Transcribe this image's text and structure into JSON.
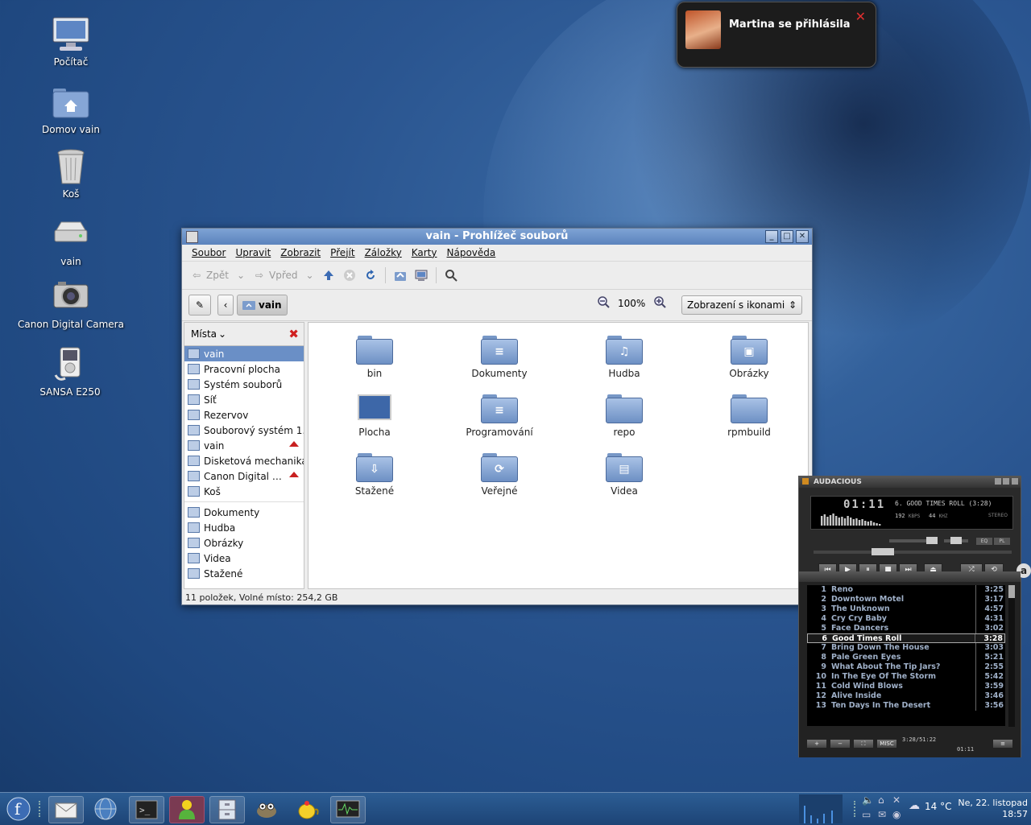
{
  "desktop": {
    "icons": [
      {
        "label": "Počítač",
        "icon": "computer-icon"
      },
      {
        "label": "Domov vain",
        "icon": "home-folder-icon"
      },
      {
        "label": "Koš",
        "icon": "trash-icon"
      },
      {
        "label": "vain",
        "icon": "drive-icon"
      },
      {
        "label": "Canon Digital Camera",
        "icon": "camera-icon"
      },
      {
        "label": "SANSA E250",
        "icon": "media-player-icon"
      }
    ]
  },
  "notification": {
    "message": "Martina se přihlásila",
    "close": "✕"
  },
  "file_manager": {
    "title": "vain - Prohlížeč souborů",
    "menu": [
      "Soubor",
      "Upravit",
      "Zobrazit",
      "Přejít",
      "Záložky",
      "Karty",
      "Nápověda"
    ],
    "toolbar": {
      "back": "Zpět",
      "forward": "Vpřed"
    },
    "breadcrumb": "vain",
    "zoom": "100%",
    "view_mode": "Zobrazení s ikonami",
    "sidebar": {
      "header": "Místa",
      "places": [
        {
          "label": "vain",
          "active": true
        },
        {
          "label": "Pracovní plocha"
        },
        {
          "label": "Systém souborů"
        },
        {
          "label": "Síť"
        },
        {
          "label": "Rezervov"
        },
        {
          "label": "Souborový systém 1…"
        },
        {
          "label": "vain",
          "eject": true
        },
        {
          "label": "Disketová mechanika"
        },
        {
          "label": "Canon Digital …",
          "eject": true
        },
        {
          "label": "Koš"
        }
      ],
      "bookmarks": [
        {
          "label": "Dokumenty"
        },
        {
          "label": "Hudba"
        },
        {
          "label": "Obrázky"
        },
        {
          "label": "Videa"
        },
        {
          "label": "Stažené"
        }
      ]
    },
    "folders": [
      {
        "label": "bin",
        "emblem": ""
      },
      {
        "label": "Dokumenty",
        "emblem": "≡"
      },
      {
        "label": "Hudba",
        "emblem": "♫"
      },
      {
        "label": "Obrázky",
        "emblem": "▣"
      },
      {
        "label": "Plocha",
        "emblem": "desktop"
      },
      {
        "label": "Programování",
        "emblem": "≡"
      },
      {
        "label": "repo",
        "emblem": ""
      },
      {
        "label": "rpmbuild",
        "emblem": ""
      },
      {
        "label": "Stažené",
        "emblem": "⇩"
      },
      {
        "label": "Veřejné",
        "emblem": "⟳"
      },
      {
        "label": "Videa",
        "emblem": "▤"
      }
    ],
    "status": "11 položek, Volné místo: 254,2 GB"
  },
  "audacious": {
    "title": "AUDACIOUS",
    "time": "01:11",
    "song": "6. GOOD TIMES ROLL (3:28)",
    "kbps": "192",
    "khz": "44",
    "kbps_unit": "KBPS",
    "khz_unit": "KHZ",
    "stereo": "STEREO",
    "eq": "EQ",
    "pl": "PL",
    "playlist": [
      {
        "n": "1",
        "title": "Reno",
        "dur": "3:25"
      },
      {
        "n": "2",
        "title": "Downtown Motel",
        "dur": "3:17"
      },
      {
        "n": "3",
        "title": "The Unknown",
        "dur": "4:57"
      },
      {
        "n": "4",
        "title": "Cry Cry Baby",
        "dur": "4:31"
      },
      {
        "n": "5",
        "title": "Face Dancers",
        "dur": "3:02"
      },
      {
        "n": "6",
        "title": "Good Times Roll",
        "dur": "3:28",
        "current": true
      },
      {
        "n": "7",
        "title": "Bring Down The House",
        "dur": "3:03"
      },
      {
        "n": "8",
        "title": "Pale Green Eyes",
        "dur": "5:21"
      },
      {
        "n": "9",
        "title": "What About The Tip Jars?",
        "dur": "2:55"
      },
      {
        "n": "10",
        "title": "In The Eye Of The Storm",
        "dur": "5:42"
      },
      {
        "n": "11",
        "title": "Cold Wind Blows",
        "dur": "3:59"
      },
      {
        "n": "12",
        "title": "Alive Inside",
        "dur": "3:46"
      },
      {
        "n": "13",
        "title": "Ten Days In The Desert",
        "dur": "3:56"
      }
    ],
    "playlist_time": "3:28/51:22",
    "elapsed": "01:11",
    "misc": "MISC"
  },
  "taskbar": {
    "temperature": "14 °C",
    "date": "Ne, 22. listopad",
    "time": "18:57"
  }
}
